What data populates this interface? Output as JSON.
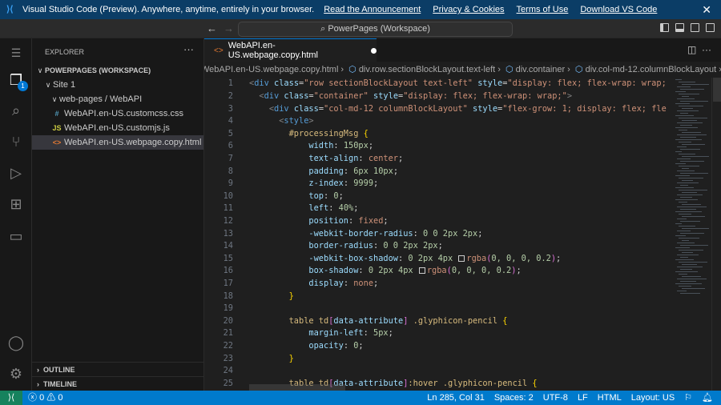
{
  "banner": {
    "text": "Visual Studio Code (Preview). Anywhere, anytime, entirely in your browser.",
    "links": [
      "Read the Announcement",
      "Privacy & Cookies",
      "Terms of Use",
      "Download VS Code"
    ]
  },
  "command": {
    "search": "PowerPages (Workspace)"
  },
  "activity": {
    "explorer_badge": "1"
  },
  "explorer": {
    "title": "EXPLORER",
    "workspace": "POWERPAGES (WORKSPACE)",
    "site": "Site 1",
    "folder": "web-pages / WebAPI",
    "files": [
      {
        "icon": "#",
        "color": "#519aba",
        "name": "WebAPI.en-US.customcss.css"
      },
      {
        "icon": "JS",
        "color": "#cbcb41",
        "name": "WebAPI.en-US.customjs.js"
      },
      {
        "icon": "<>",
        "color": "#e37933",
        "name": "WebAPI.en-US.webpage.copy.html"
      }
    ],
    "outline": "OUTLINE",
    "timeline": "TIMELINE"
  },
  "tab": {
    "label": "WebAPI.en-US.webpage.copy.html"
  },
  "breadcrumbs": [
    "WebAPI.en-US.webpage.copy.html",
    "div.row.sectionBlockLayout.text-left",
    "div.container",
    "div.col-md-12.columnBlockLayout"
  ],
  "code": [
    [
      [
        "p",
        "<"
      ],
      [
        "tag",
        "div"
      ],
      [
        "pl",
        " "
      ],
      [
        "at",
        "class"
      ],
      [
        "pl",
        "="
      ],
      [
        "s",
        "\"row sectionBlockLayout text-left\""
      ],
      [
        "pl",
        " "
      ],
      [
        "at",
        "style"
      ],
      [
        "pl",
        "="
      ],
      [
        "s",
        "\"display: flex; flex-wrap: wrap; "
      ]
    ],
    [
      [
        "pl",
        "  "
      ],
      [
        "p",
        "<"
      ],
      [
        "tag",
        "div"
      ],
      [
        "pl",
        " "
      ],
      [
        "at",
        "class"
      ],
      [
        "pl",
        "="
      ],
      [
        "s",
        "\"container\""
      ],
      [
        "pl",
        " "
      ],
      [
        "at",
        "style"
      ],
      [
        "pl",
        "="
      ],
      [
        "s",
        "\"display: flex; flex-wrap: wrap;\""
      ],
      [
        "p",
        ">"
      ]
    ],
    [
      [
        "pl",
        "    "
      ],
      [
        "p",
        "<"
      ],
      [
        "tag",
        "div"
      ],
      [
        "pl",
        " "
      ],
      [
        "at",
        "class"
      ],
      [
        "pl",
        "="
      ],
      [
        "s",
        "\"col-md-12 columnBlockLayout\""
      ],
      [
        "pl",
        " "
      ],
      [
        "at",
        "style"
      ],
      [
        "pl",
        "="
      ],
      [
        "s",
        "\"flex-grow: 1; display: flex; fle"
      ]
    ],
    [
      [
        "pl",
        "      "
      ],
      [
        "p",
        "<"
      ],
      [
        "tag",
        "style"
      ],
      [
        "p",
        ">"
      ]
    ],
    [
      [
        "pl",
        "        "
      ],
      [
        "sel",
        "#processingMsg"
      ],
      [
        "pl",
        " "
      ],
      [
        "b",
        "{"
      ]
    ],
    [
      [
        "pl",
        "            "
      ],
      [
        "pr",
        "width"
      ],
      [
        "pl",
        ": "
      ],
      [
        "n",
        "150px"
      ],
      [
        "pl",
        ";"
      ]
    ],
    [
      [
        "pl",
        "            "
      ],
      [
        "pr",
        "text-align"
      ],
      [
        "pl",
        ": "
      ],
      [
        "v",
        "center"
      ],
      [
        "pl",
        ";"
      ]
    ],
    [
      [
        "pl",
        "            "
      ],
      [
        "pr",
        "padding"
      ],
      [
        "pl",
        ": "
      ],
      [
        "n",
        "6px 10px"
      ],
      [
        "pl",
        ";"
      ]
    ],
    [
      [
        "pl",
        "            "
      ],
      [
        "pr",
        "z-index"
      ],
      [
        "pl",
        ": "
      ],
      [
        "n",
        "9999"
      ],
      [
        "pl",
        ";"
      ]
    ],
    [
      [
        "pl",
        "            "
      ],
      [
        "pr",
        "top"
      ],
      [
        "pl",
        ": "
      ],
      [
        "n",
        "0"
      ],
      [
        "pl",
        ";"
      ]
    ],
    [
      [
        "pl",
        "            "
      ],
      [
        "pr",
        "left"
      ],
      [
        "pl",
        ": "
      ],
      [
        "n",
        "40%"
      ],
      [
        "pl",
        ";"
      ]
    ],
    [
      [
        "pl",
        "            "
      ],
      [
        "pr",
        "position"
      ],
      [
        "pl",
        ": "
      ],
      [
        "v",
        "fixed"
      ],
      [
        "pl",
        ";"
      ]
    ],
    [
      [
        "pl",
        "            "
      ],
      [
        "pr",
        "-webkit-border-radius"
      ],
      [
        "pl",
        ": "
      ],
      [
        "n",
        "0 0 2px 2px"
      ],
      [
        "pl",
        ";"
      ]
    ],
    [
      [
        "pl",
        "            "
      ],
      [
        "pr",
        "border-radius"
      ],
      [
        "pl",
        ": "
      ],
      [
        "n",
        "0 0 2px 2px"
      ],
      [
        "pl",
        ";"
      ]
    ],
    [
      [
        "pl",
        "            "
      ],
      [
        "pr",
        "-webkit-box-shadow"
      ],
      [
        "pl",
        ": "
      ],
      [
        "n",
        "0 2px 4px "
      ],
      [
        "sw",
        ""
      ],
      [
        "v",
        "rgba"
      ],
      [
        "b2",
        "("
      ],
      [
        "n",
        "0, 0, 0, 0.2"
      ],
      [
        "b2",
        ")"
      ],
      [
        "pl",
        ";"
      ]
    ],
    [
      [
        "pl",
        "            "
      ],
      [
        "pr",
        "box-shadow"
      ],
      [
        "pl",
        ": "
      ],
      [
        "n",
        "0 2px 4px "
      ],
      [
        "sw",
        ""
      ],
      [
        "v",
        "rgba"
      ],
      [
        "b2",
        "("
      ],
      [
        "n",
        "0, 0, 0, 0.2"
      ],
      [
        "b2",
        ")"
      ],
      [
        "pl",
        ";"
      ]
    ],
    [
      [
        "pl",
        "            "
      ],
      [
        "pr",
        "display"
      ],
      [
        "pl",
        ": "
      ],
      [
        "v",
        "none"
      ],
      [
        "pl",
        ";"
      ]
    ],
    [
      [
        "pl",
        "        "
      ],
      [
        "b",
        "}"
      ]
    ],
    [],
    [
      [
        "pl",
        "        "
      ],
      [
        "sel",
        "table td"
      ],
      [
        "b2",
        "["
      ],
      [
        "at",
        "data-attribute"
      ],
      [
        "b2",
        "]"
      ],
      [
        "pl",
        " "
      ],
      [
        "sel",
        ".glyphicon-pencil"
      ],
      [
        "pl",
        " "
      ],
      [
        "b",
        "{"
      ]
    ],
    [
      [
        "pl",
        "            "
      ],
      [
        "pr",
        "margin-left"
      ],
      [
        "pl",
        ": "
      ],
      [
        "n",
        "5px"
      ],
      [
        "pl",
        ";"
      ]
    ],
    [
      [
        "pl",
        "            "
      ],
      [
        "pr",
        "opacity"
      ],
      [
        "pl",
        ": "
      ],
      [
        "n",
        "0"
      ],
      [
        "pl",
        ";"
      ]
    ],
    [
      [
        "pl",
        "        "
      ],
      [
        "b",
        "}"
      ]
    ],
    [],
    [
      [
        "pl",
        "        "
      ],
      [
        "sel",
        "table td"
      ],
      [
        "b2",
        "["
      ],
      [
        "at",
        "data-attribute"
      ],
      [
        "b2",
        "]"
      ],
      [
        "sel",
        ":hover .glyphicon-pencil"
      ],
      [
        "pl",
        " "
      ],
      [
        "b",
        "{"
      ]
    ]
  ],
  "status": {
    "errors": "0",
    "warnings": "0",
    "position": "Ln 285, Col 31",
    "spaces": "Spaces: 2",
    "encoding": "UTF-8",
    "eol": "LF",
    "language": "HTML",
    "layout": "Layout: US"
  }
}
